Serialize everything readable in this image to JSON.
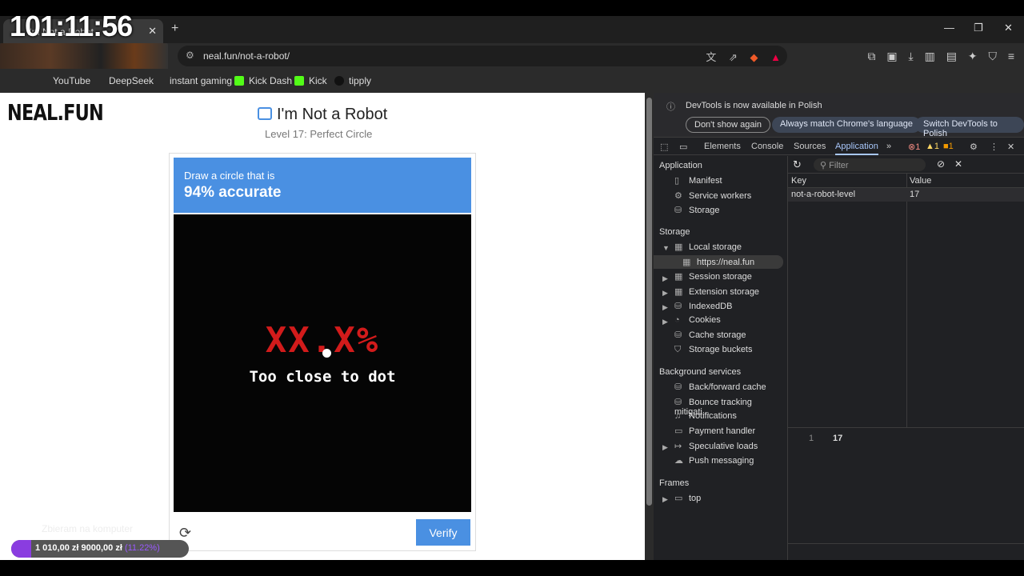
{
  "timer": "101:11:56",
  "browser": {
    "tab_title": "I'm Not a Robot",
    "url": "neal.fun/not-a-robot/",
    "bookmarks": [
      "YouTube",
      "DeepSeek",
      "instant gaming",
      "Kick Dash",
      "Kick",
      "tipply"
    ]
  },
  "page": {
    "logo": "NEAL.FUN",
    "title": "I'm Not a Robot",
    "subtitle": "Level 17: Perfect Circle",
    "prompt_line1": "Draw a circle that is",
    "prompt_line2": "94% accurate",
    "canvas_percent": "XX.X%",
    "canvas_message": "Too close to dot",
    "verify_label": "Verify"
  },
  "overlay": {
    "donation_label": "Zbieram na komputer",
    "donation_text": "1 010,00 zł",
    "donation_goal": "9000,00 zł",
    "donation_pct": "(11.22%)",
    "donation_progress": 0.1122
  },
  "devtools": {
    "info_message": "DevTools is now available in Polish",
    "btn_dont_show": "Don't show again",
    "btn_match": "Always match Chrome's language",
    "btn_switch": "Switch DevTools to Polish",
    "tabs": [
      "Elements",
      "Console",
      "Sources",
      "Application"
    ],
    "errors": "1",
    "warnings": "1",
    "issues": "1",
    "sidebar": {
      "application_header": "Application",
      "application_items": [
        "Manifest",
        "Service workers",
        "Storage"
      ],
      "storage_header": "Storage",
      "local_storage": "Local storage",
      "local_origin": "https://neal.fun",
      "storage_items": [
        "Session storage",
        "Extension storage",
        "IndexedDB",
        "Cookies",
        "Cache storage",
        "Storage buckets"
      ],
      "background_header": "Background services",
      "background_items": [
        "Back/forward cache",
        "Bounce tracking mitigati...",
        "Notifications",
        "Payment handler",
        "Speculative loads",
        "Push messaging"
      ],
      "frames_header": "Frames",
      "frames_item": "top"
    },
    "filter_placeholder": "Filter",
    "table": {
      "col_key": "Key",
      "col_value": "Value",
      "row_key": "not-a-robot-level",
      "row_value": "17"
    },
    "preview_line": "1",
    "preview_value": "17"
  }
}
